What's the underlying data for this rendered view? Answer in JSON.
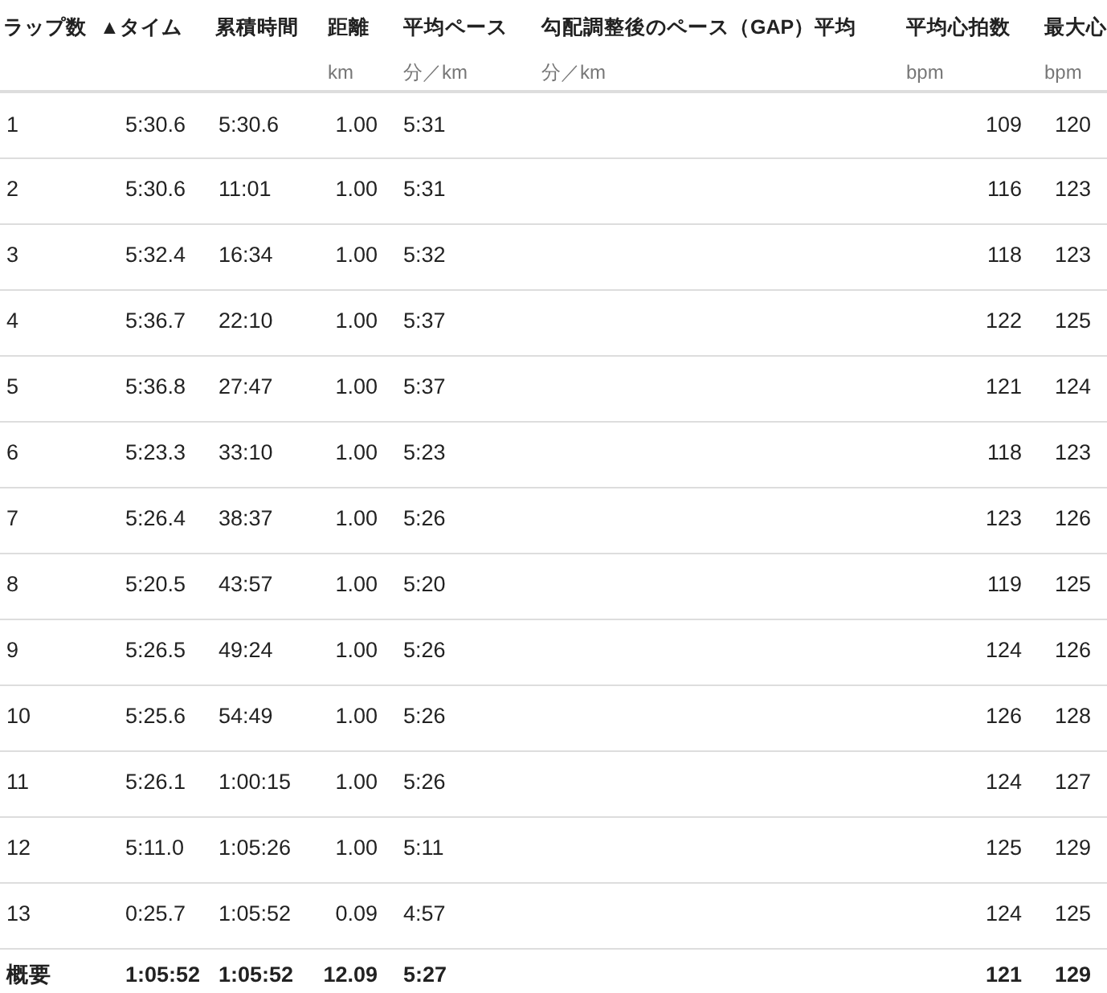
{
  "table": {
    "columns": [
      {
        "label": "ラップ数"
      },
      {
        "label": "タイム",
        "sort_indicator": "▲"
      },
      {
        "label": "累積時間"
      },
      {
        "label": "距離",
        "unit": "km"
      },
      {
        "label": "平均ペース",
        "unit": "分／km"
      },
      {
        "label": "勾配調整後のペース（GAP）平均",
        "unit": "分／km"
      },
      {
        "label": "平均心拍数",
        "unit": "bpm"
      },
      {
        "label": "最大心",
        "unit": "bpm"
      }
    ],
    "rows": [
      {
        "lap": "1",
        "time": "5:30.6",
        "cumulative": "5:30.6",
        "distance": "1.00",
        "pace": "5:31",
        "avg_hr": "109",
        "max_hr": "120"
      },
      {
        "lap": "2",
        "time": "5:30.6",
        "cumulative": "11:01",
        "distance": "1.00",
        "pace": "5:31",
        "avg_hr": "116",
        "max_hr": "123"
      },
      {
        "lap": "3",
        "time": "5:32.4",
        "cumulative": "16:34",
        "distance": "1.00",
        "pace": "5:32",
        "avg_hr": "118",
        "max_hr": "123"
      },
      {
        "lap": "4",
        "time": "5:36.7",
        "cumulative": "22:10",
        "distance": "1.00",
        "pace": "5:37",
        "avg_hr": "122",
        "max_hr": "125"
      },
      {
        "lap": "5",
        "time": "5:36.8",
        "cumulative": "27:47",
        "distance": "1.00",
        "pace": "5:37",
        "avg_hr": "121",
        "max_hr": "124"
      },
      {
        "lap": "6",
        "time": "5:23.3",
        "cumulative": "33:10",
        "distance": "1.00",
        "pace": "5:23",
        "avg_hr": "118",
        "max_hr": "123"
      },
      {
        "lap": "7",
        "time": "5:26.4",
        "cumulative": "38:37",
        "distance": "1.00",
        "pace": "5:26",
        "avg_hr": "123",
        "max_hr": "126"
      },
      {
        "lap": "8",
        "time": "5:20.5",
        "cumulative": "43:57",
        "distance": "1.00",
        "pace": "5:20",
        "avg_hr": "119",
        "max_hr": "125"
      },
      {
        "lap": "9",
        "time": "5:26.5",
        "cumulative": "49:24",
        "distance": "1.00",
        "pace": "5:26",
        "avg_hr": "124",
        "max_hr": "126"
      },
      {
        "lap": "10",
        "time": "5:25.6",
        "cumulative": "54:49",
        "distance": "1.00",
        "pace": "5:26",
        "avg_hr": "126",
        "max_hr": "128"
      },
      {
        "lap": "11",
        "time": "5:26.1",
        "cumulative": "1:00:15",
        "distance": "1.00",
        "pace": "5:26",
        "avg_hr": "124",
        "max_hr": "127"
      },
      {
        "lap": "12",
        "time": "5:11.0",
        "cumulative": "1:05:26",
        "distance": "1.00",
        "pace": "5:11",
        "avg_hr": "125",
        "max_hr": "129"
      },
      {
        "lap": "13",
        "time": "0:25.7",
        "cumulative": "1:05:52",
        "distance": "0.09",
        "pace": "4:57",
        "avg_hr": "124",
        "max_hr": "125"
      }
    ],
    "summary": {
      "lap": "概要",
      "time": "1:05:52",
      "cumulative": "1:05:52",
      "distance": "12.09",
      "pace": "5:27",
      "avg_hr": "121",
      "max_hr": "129"
    }
  }
}
